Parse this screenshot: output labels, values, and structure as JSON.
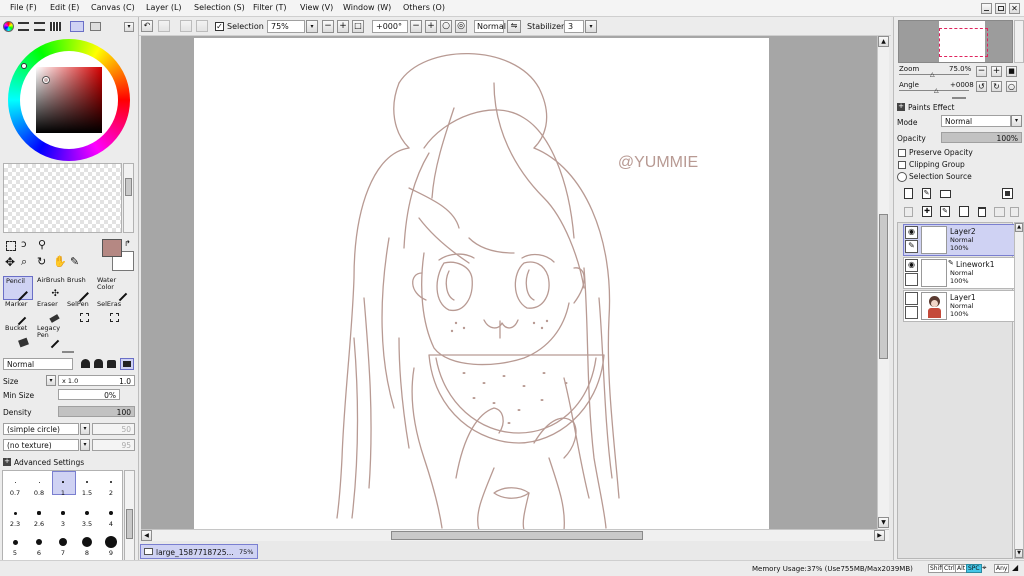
{
  "menu": [
    "File (F)",
    "Edit (E)",
    "Canvas (C)",
    "Layer (L)",
    "Selection (S)",
    "Filter (T)",
    "View (V)",
    "Window (W)",
    "Others (O)"
  ],
  "colors": {
    "main_color": "#b58883",
    "sub_color": "#ffffff",
    "accent_select": "#cfd2f3",
    "lineart": "#b89a93"
  },
  "tools": [
    [
      "Pencil",
      "AirBrush",
      "Brush",
      "Water Color"
    ],
    [
      "Marker",
      "Eraser",
      "SelPen",
      "SelEras"
    ],
    [
      "Bucket",
      "Legacy Pen"
    ]
  ],
  "brush": {
    "blend_mode": "Normal",
    "size_label": "Size",
    "size_multiplier": "x 1.0",
    "size_value": "1.0",
    "min_size_label": "Min Size",
    "min_size_value": "0%",
    "density_label": "Density",
    "density_value": "100",
    "density_fraction": 1.0,
    "shape": "(simple circle)",
    "shape_value": "50",
    "texture": "(no texture)",
    "texture_value": "95",
    "advanced": "Advanced Settings",
    "dot_sizes": [
      [
        "0.7",
        "0.8",
        "1",
        "1.5",
        "2"
      ],
      [
        "2.3",
        "2.6",
        "3",
        "3.5",
        "4"
      ],
      [
        "5",
        "6",
        "7",
        "8",
        "9"
      ]
    ]
  },
  "toolbar": {
    "selection_label": "Selection",
    "zoom": "75%",
    "angle": "+000°",
    "mode": "Normal",
    "stabilizer_label": "Stabilizer",
    "stabilizer_value": "3"
  },
  "canvas": {
    "watermark": "@YUMMIE",
    "tab_name": "large_1587718725...",
    "tab_zoom": "75%"
  },
  "navigator": {
    "zoom_label": "Zoom",
    "zoom_value": "75.0%",
    "angle_label": "Angle",
    "angle_value": "+0008"
  },
  "layer_panel": {
    "paints_effect": "Paints Effect",
    "mode_label": "Mode",
    "mode_value": "Normal",
    "opacity_label": "Opacity",
    "opacity_value": "100%",
    "preserve_opacity": "Preserve Opacity",
    "clipping_group": "Clipping Group",
    "selection_source": "Selection Source",
    "layers": [
      {
        "name": "Layer2",
        "mode": "Normal",
        "opacity": "100%"
      },
      {
        "name": "Linework1",
        "mode": "Normal",
        "opacity": "100%"
      },
      {
        "name": "Layer1",
        "mode": "Normal",
        "opacity": "100%"
      }
    ]
  },
  "status": {
    "memory": "Memory Usage:37% (Use755MB/Max2039MB)",
    "keys": [
      "Shift",
      "Ctrl",
      "Alt",
      "SPC",
      "Any"
    ]
  }
}
